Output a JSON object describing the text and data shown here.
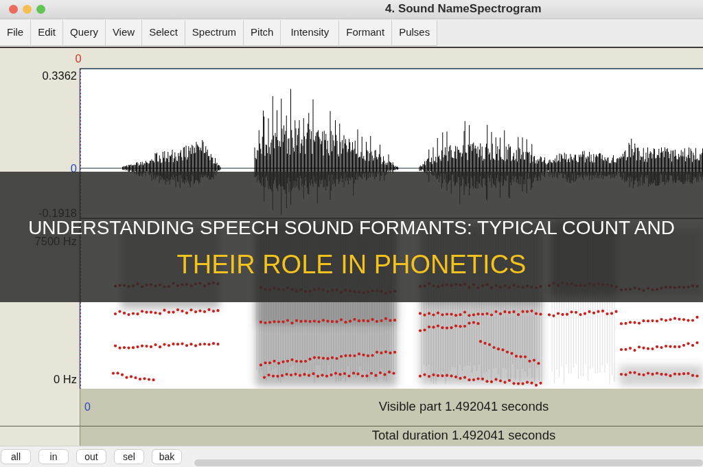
{
  "window": {
    "title": "4. Sound NameSpectrogram"
  },
  "menu": [
    "File",
    "Edit",
    "Query",
    "View",
    "Select",
    "Spectrum",
    "Pitch",
    "Intensity",
    "Formant",
    "Pulses"
  ],
  "editor": {
    "cursor_time": "0",
    "waveform_max": "0.3362",
    "waveform_zero": "0",
    "waveform_min": "-0.1918",
    "spectrogram_max": "7500 Hz",
    "spectrogram_min": "0 Hz"
  },
  "time_bar": {
    "start_time": "0",
    "visible_part": "Visible part 1.492041 seconds",
    "total_duration": "Total duration 1.492041 seconds"
  },
  "zoom_buttons": [
    "all",
    "in",
    "out",
    "sel",
    "bak"
  ],
  "headline": [
    {
      "text": "UNDERSTANDING SPEECH SOUND FORMANTS: TYPICAL COUNT AND",
      "highlighted": false
    },
    {
      "text": "THEIR ROLE IN PHONETICS",
      "highlighted": true
    }
  ]
}
